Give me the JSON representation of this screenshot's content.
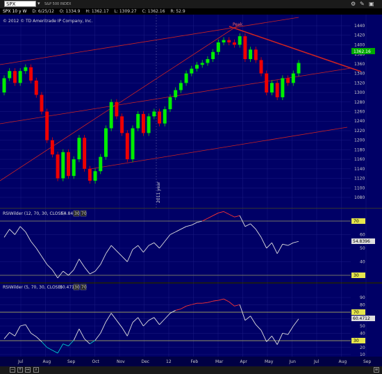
{
  "toolbar": {
    "symbol": "SPX",
    "company": "S&P 500 INDEX"
  },
  "info": {
    "study": "SPX 10 y W",
    "date": "D: 6/25/12",
    "open": "O: 1334.9",
    "high": "H: 1362.17",
    "low": "L: 1309.27",
    "close": "C: 1362.16",
    "range": "R: 52.9",
    "copyright": "© 2012 © TD Ameritrade IP Company, Inc."
  },
  "price_axis": [
    "1440",
    "1420",
    "1400",
    "1380",
    "1360",
    "1340",
    "1320",
    "1300",
    "1280",
    "1260",
    "1240",
    "1220",
    "1200",
    "1180",
    "1160",
    "1140",
    "1120",
    "1100",
    "1080"
  ],
  "last_price": "1362.16",
  "annotations": {
    "peak": "Peak",
    "year": "2011 year"
  },
  "time_axis": [
    "Jul",
    "Aug",
    "Sep",
    "Oct",
    "Nov",
    "Dec",
    "12",
    "Feb",
    "Mar",
    "Apr",
    "May",
    "Jun",
    "Jul",
    "Aug",
    "Sep"
  ],
  "rsi1": {
    "title": "RSIWilder (12, 70, 30, CLOSE)",
    "value": "54.84",
    "ob": "30",
    "os": "70",
    "axis": [
      "70",
      "60",
      "50",
      "40",
      "30"
    ],
    "label_value": "54.8396",
    "label_70": "70",
    "label_30": "30"
  },
  "rsi2": {
    "title": "RSIWilder (5, 70, 30, CLOSE)",
    "value": "60.471",
    "ob": "30",
    "os": "70",
    "axis": [
      "90",
      "80",
      "70",
      "60",
      "50",
      "40",
      "30",
      "20",
      "10"
    ],
    "label_value": "60.4712",
    "label_70": "70",
    "label_30": "30"
  },
  "colors": {
    "bg": "#000066",
    "up": "#00ee00",
    "down": "#ee0000",
    "trend": "#cc2222",
    "rsi": "#e0e0e0",
    "rsi_hot": "#ff3333",
    "rsi_cold": "#00cccc",
    "level": "#e6e64c"
  },
  "candles": [
    {
      "o": 1300,
      "c": 1330
    },
    {
      "o": 1330,
      "c": 1345
    },
    {
      "o": 1345,
      "c": 1320
    },
    {
      "o": 1320,
      "c": 1345
    },
    {
      "o": 1345,
      "c": 1353
    },
    {
      "o": 1353,
      "c": 1325
    },
    {
      "o": 1325,
      "c": 1295
    },
    {
      "o": 1295,
      "c": 1260
    },
    {
      "o": 1260,
      "c": 1200
    },
    {
      "o": 1200,
      "c": 1170
    },
    {
      "o": 1170,
      "c": 1120
    },
    {
      "o": 1120,
      "c": 1175
    },
    {
      "o": 1175,
      "c": 1125
    },
    {
      "o": 1125,
      "c": 1160
    },
    {
      "o": 1160,
      "c": 1205
    },
    {
      "o": 1205,
      "c": 1140
    },
    {
      "o": 1140,
      "c": 1115
    },
    {
      "o": 1115,
      "c": 1135
    },
    {
      "o": 1135,
      "c": 1165
    },
    {
      "o": 1165,
      "c": 1225
    },
    {
      "o": 1225,
      "c": 1280
    },
    {
      "o": 1280,
      "c": 1250
    },
    {
      "o": 1250,
      "c": 1215
    },
    {
      "o": 1215,
      "c": 1160
    },
    {
      "o": 1160,
      "c": 1225
    },
    {
      "o": 1225,
      "c": 1255
    },
    {
      "o": 1255,
      "c": 1215
    },
    {
      "o": 1215,
      "c": 1250
    },
    {
      "o": 1250,
      "c": 1260
    },
    {
      "o": 1260,
      "c": 1235
    },
    {
      "o": 1235,
      "c": 1265
    },
    {
      "o": 1265,
      "c": 1290
    },
    {
      "o": 1290,
      "c": 1305
    },
    {
      "o": 1305,
      "c": 1320
    },
    {
      "o": 1320,
      "c": 1340
    },
    {
      "o": 1340,
      "c": 1350
    },
    {
      "o": 1350,
      "c": 1358
    },
    {
      "o": 1358,
      "c": 1362
    },
    {
      "o": 1362,
      "c": 1370
    },
    {
      "o": 1370,
      "c": 1385
    },
    {
      "o": 1385,
      "c": 1405
    },
    {
      "o": 1405,
      "c": 1410
    },
    {
      "o": 1410,
      "c": 1405
    },
    {
      "o": 1405,
      "c": 1400
    },
    {
      "o": 1400,
      "c": 1418
    },
    {
      "o": 1418,
      "c": 1370
    },
    {
      "o": 1370,
      "c": 1390
    },
    {
      "o": 1390,
      "c": 1368
    },
    {
      "o": 1368,
      "c": 1340
    },
    {
      "o": 1340,
      "c": 1300
    },
    {
      "o": 1300,
      "c": 1320
    },
    {
      "o": 1320,
      "c": 1290
    },
    {
      "o": 1290,
      "c": 1330
    },
    {
      "o": 1330,
      "c": 1320
    },
    {
      "o": 1320,
      "c": 1340
    },
    {
      "o": 1340,
      "c": 1362
    }
  ],
  "rsi1_values": [
    58,
    64,
    60,
    66,
    62,
    55,
    50,
    44,
    38,
    34,
    28,
    33,
    30,
    34,
    42,
    36,
    31,
    33,
    38,
    46,
    52,
    48,
    44,
    40,
    49,
    52,
    47,
    52,
    54,
    50,
    55,
    60,
    62,
    64,
    66,
    67,
    69,
    70,
    72,
    74,
    76,
    77,
    75,
    73,
    74,
    66,
    68,
    64,
    58,
    50,
    54,
    46,
    53,
    52,
    54,
    55
  ],
  "rsi2_values": [
    32,
    41,
    36,
    50,
    52,
    40,
    35,
    28,
    20,
    16,
    12,
    25,
    22,
    30,
    46,
    32,
    25,
    30,
    40,
    56,
    68,
    58,
    48,
    36,
    55,
    62,
    50,
    58,
    62,
    52,
    60,
    68,
    72,
    74,
    78,
    80,
    82,
    82,
    83,
    85,
    86,
    88,
    84,
    78,
    80,
    58,
    64,
    52,
    44,
    28,
    36,
    24,
    40,
    38,
    50,
    60
  ]
}
